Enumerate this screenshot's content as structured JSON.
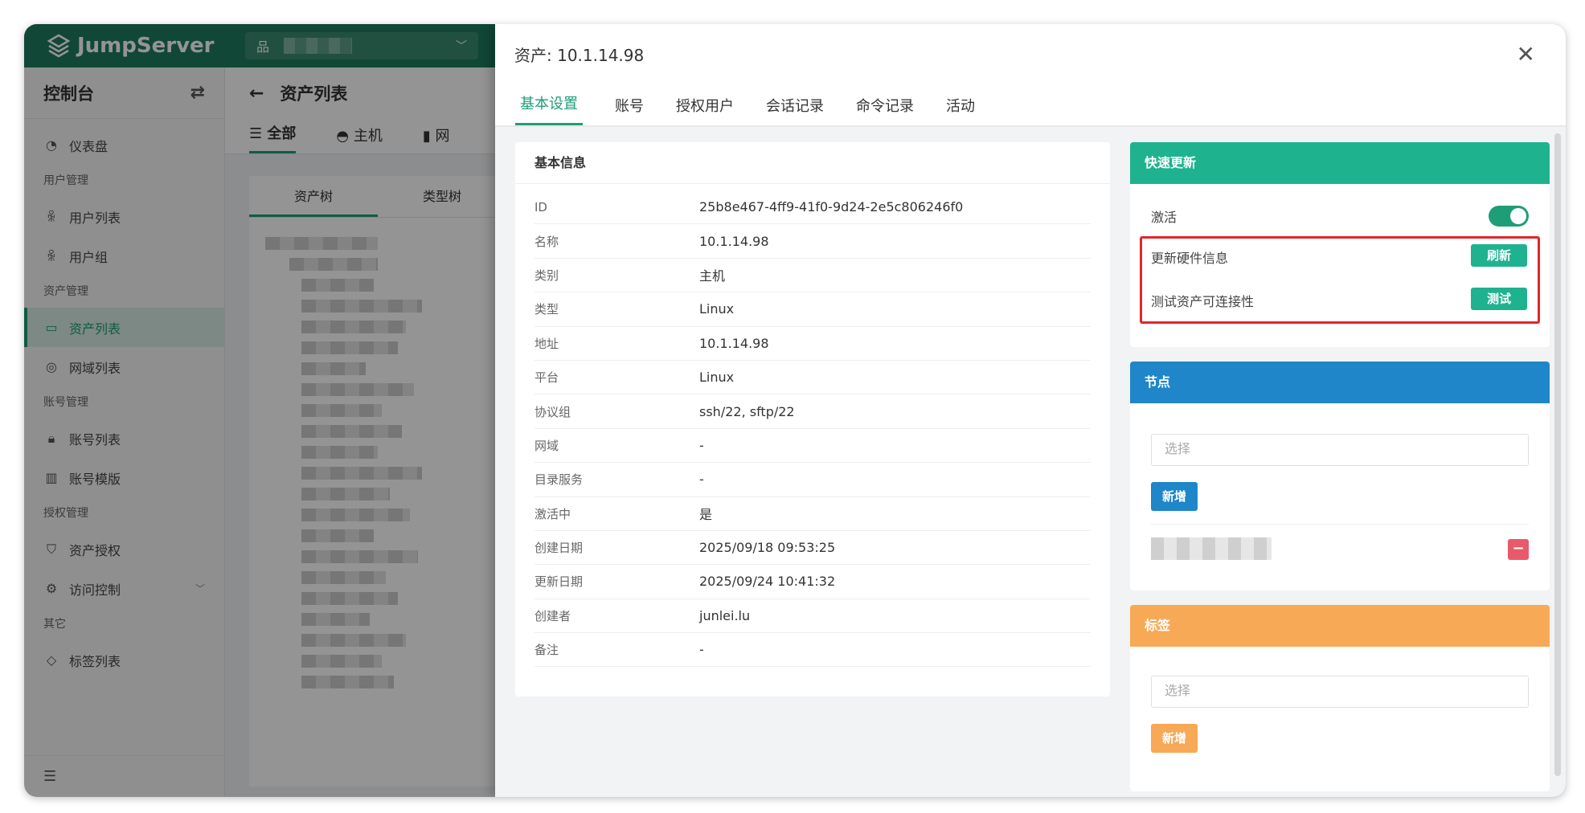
{
  "app": {
    "logo": "JumpServer",
    "brand_color": "#1e7a5e",
    "accent_color": "#1e9e76",
    "org_icon": "org-tree-icon"
  },
  "sidebar": {
    "title": "控制台",
    "sections": [
      {
        "group": "",
        "items": [
          {
            "label": "仪表盘",
            "icon": "dashboard-icon"
          }
        ]
      },
      {
        "group": "用户管理",
        "items": [
          {
            "label": "用户列表",
            "icon": "user-icon"
          },
          {
            "label": "用户组",
            "icon": "users-icon"
          }
        ]
      },
      {
        "group": "资产管理",
        "items": [
          {
            "label": "资产列表",
            "icon": "monitor-icon",
            "active": true
          },
          {
            "label": "网域列表",
            "icon": "location-icon"
          }
        ]
      },
      {
        "group": "账号管理",
        "items": [
          {
            "label": "账号列表",
            "icon": "lock-icon"
          },
          {
            "label": "账号模版",
            "icon": "template-icon"
          }
        ]
      },
      {
        "group": "授权管理",
        "items": [
          {
            "label": "资产授权",
            "icon": "shield-icon"
          },
          {
            "label": "访问控制",
            "icon": "access-icon",
            "expandable": true
          }
        ]
      },
      {
        "group": "其它",
        "items": [
          {
            "label": "标签列表",
            "icon": "tag-icon"
          }
        ]
      }
    ],
    "flat": {
      "g1": "用户管理",
      "g2": "资产管理",
      "g3": "账号管理",
      "g4": "授权管理",
      "g5": "其它",
      "i0": "仪表盘",
      "i1": "用户列表",
      "i2": "用户组",
      "i3": "资产列表",
      "i4": "网域列表",
      "i5": "账号列表",
      "i6": "账号模版",
      "i7": "资产授权",
      "i8": "访问控制",
      "i9": "标签列表"
    }
  },
  "main": {
    "title": "资产列表",
    "tabs": [
      "全部",
      "主机",
      "网"
    ],
    "tree_tabs": [
      "资产树",
      "类型树"
    ]
  },
  "drawer": {
    "title": "资产: 10.1.14.98",
    "tabs": [
      "基本设置",
      "账号",
      "授权用户",
      "会话记录",
      "命令记录",
      "活动"
    ],
    "basic_info": {
      "title": "基本信息",
      "rows": [
        {
          "k": "ID",
          "v": "25b8e467-4ff9-41f0-9d24-2e5c806246f0"
        },
        {
          "k": "名称",
          "v": "10.1.14.98"
        },
        {
          "k": "类别",
          "v": "主机"
        },
        {
          "k": "类型",
          "v": "Linux"
        },
        {
          "k": "地址",
          "v": "10.1.14.98"
        },
        {
          "k": "平台",
          "v": "Linux"
        },
        {
          "k": "协议组",
          "v": "ssh/22, sftp/22"
        },
        {
          "k": "网域",
          "v": "-"
        },
        {
          "k": "目录服务",
          "v": "-"
        },
        {
          "k": "激活中",
          "v": "是"
        },
        {
          "k": "创建日期",
          "v": "2025/09/18 09:53:25"
        },
        {
          "k": "更新日期",
          "v": "2025/09/24 10:41:32"
        },
        {
          "k": "创建者",
          "v": "junlei.lu"
        },
        {
          "k": "备注",
          "v": "-"
        }
      ]
    },
    "quick_update": {
      "title": "快速更新",
      "color": "#1fb28f",
      "active_label": "激活",
      "active_on": true,
      "hw_label": "更新硬件信息",
      "hw_button": "刷新",
      "conn_label": "测试资产可连接性",
      "conn_button": "测试"
    },
    "nodes": {
      "title": "节点",
      "color": "#1f86c9",
      "placeholder": "选择",
      "add_button": "新增"
    },
    "labels": {
      "title": "标签",
      "color": "#f7a956",
      "placeholder": "选择",
      "add_button": "新增"
    }
  }
}
